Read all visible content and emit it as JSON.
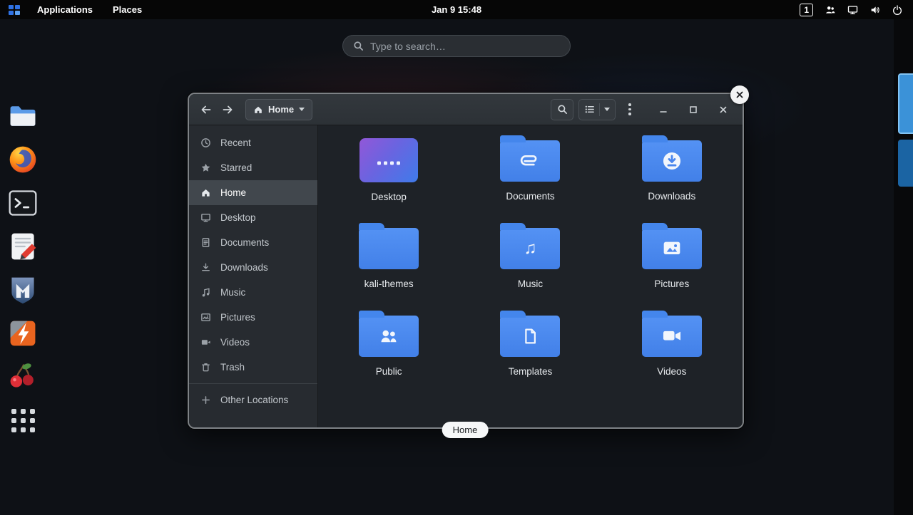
{
  "colors": {
    "accent": "#3584e4",
    "folder_blue": "#4a86ee",
    "topbar_bg": "#060606",
    "window_bg": "#1e2227",
    "sidebar_bg": "#272b30",
    "selection_bg": "#41474d",
    "workspace_active_border": "#82c4f4"
  },
  "topbar": {
    "menus": [
      {
        "label": "Applications"
      },
      {
        "label": "Places"
      }
    ],
    "clock": "Jan 9 15:48",
    "workspace_indicator": "1"
  },
  "search": {
    "placeholder": "Type to search…"
  },
  "dock": {
    "items": [
      {
        "icon": "files-icon"
      },
      {
        "icon": "firefox-icon"
      },
      {
        "icon": "terminal-icon"
      },
      {
        "icon": "text-editor-icon"
      },
      {
        "icon": "metasploit-icon"
      },
      {
        "icon": "burpsuite-icon"
      },
      {
        "icon": "cherrytree-icon"
      },
      {
        "icon": "show-applications-icon"
      }
    ]
  },
  "window": {
    "path_button": "Home",
    "title_pill": "Home",
    "sidebar": {
      "items": [
        {
          "label": "Recent",
          "icon": "clock-icon"
        },
        {
          "label": "Starred",
          "icon": "star-icon"
        },
        {
          "label": "Home",
          "icon": "home-icon",
          "selected": true
        },
        {
          "label": "Desktop",
          "icon": "desktop-icon"
        },
        {
          "label": "Documents",
          "icon": "document-icon"
        },
        {
          "label": "Downloads",
          "icon": "download-icon"
        },
        {
          "label": "Music",
          "icon": "music-note-icon"
        },
        {
          "label": "Pictures",
          "icon": "image-icon"
        },
        {
          "label": "Videos",
          "icon": "video-camera-icon"
        },
        {
          "label": "Trash",
          "icon": "trash-icon"
        },
        {
          "label": "Other Locations",
          "icon": "plus-icon"
        }
      ]
    },
    "files": [
      {
        "name": "Desktop",
        "emblem": "desktop-screen"
      },
      {
        "name": "Documents",
        "emblem": "paperclip"
      },
      {
        "name": "Downloads",
        "emblem": "download-arrow"
      },
      {
        "name": "kali-themes",
        "emblem": "none"
      },
      {
        "name": "Music",
        "emblem": "music-note"
      },
      {
        "name": "Pictures",
        "emblem": "image"
      },
      {
        "name": "Public",
        "emblem": "people"
      },
      {
        "name": "Templates",
        "emblem": "template-document"
      },
      {
        "name": "Videos",
        "emblem": "video-camera"
      }
    ],
    "glyphs": {
      "music_emblem": "♫"
    }
  },
  "workspaces": {
    "count": 2,
    "active": 1
  },
  "icons": {
    "topbar": [
      "kali-logo",
      "users-icon",
      "display-icon",
      "speaker-icon",
      "power-icon"
    ],
    "headerbar": [
      "back-icon",
      "forward-icon",
      "home-icon",
      "caret-down-icon",
      "search-icon",
      "list-view-icon",
      "menu-kebab-icon",
      "minimize-icon",
      "maximize-icon",
      "close-icon"
    ],
    "overview": [
      "close-icon"
    ]
  }
}
